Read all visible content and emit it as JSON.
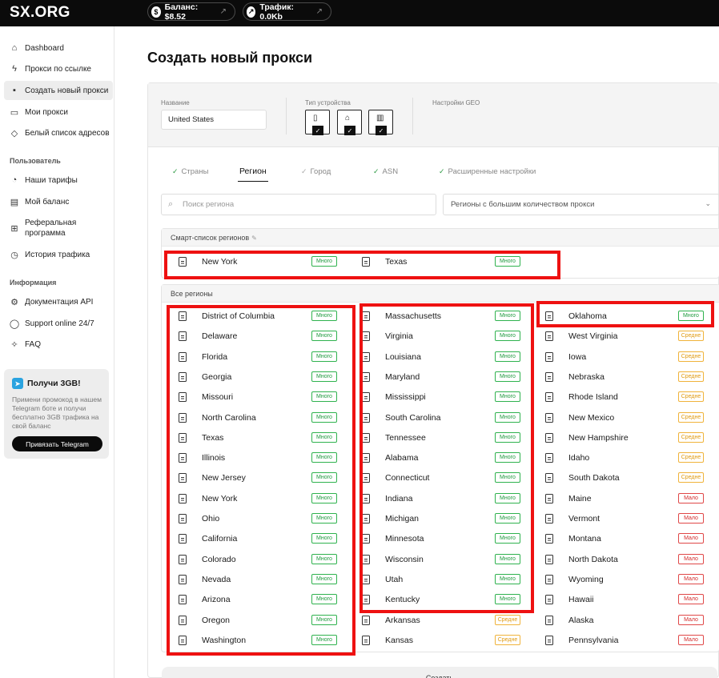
{
  "header": {
    "logo": "SX.ORG",
    "balance_label": "Баланс: $8.52",
    "traffic_label": "Трафик: 0.0Kb"
  },
  "sidebar": {
    "items": [
      {
        "label": "Dashboard",
        "icon": "home-icon"
      },
      {
        "label": "Прокси по ссылке",
        "icon": "bolt-icon"
      },
      {
        "label": "Создать новый прокси",
        "icon": "file-plus-icon",
        "active": true
      },
      {
        "label": "Мои прокси",
        "icon": "list-icon"
      },
      {
        "label": "Белый список адресов",
        "icon": "shield-icon"
      }
    ],
    "user_section": "Пользователь",
    "user_items": [
      {
        "label": "Наши тарифы",
        "icon": "tag-icon"
      },
      {
        "label": "Мой баланс",
        "icon": "wallet-icon"
      },
      {
        "label": "Реферальная программа",
        "icon": "gift-icon"
      },
      {
        "label": "История трафика",
        "icon": "clock-icon"
      }
    ],
    "info_section": "Информация",
    "info_items": [
      {
        "label": "Документация API",
        "icon": "gear-icon"
      },
      {
        "label": "Support online 24/7",
        "icon": "chat-icon"
      },
      {
        "label": "FAQ",
        "icon": "sparkle-icon"
      }
    ],
    "promo": {
      "title": "Получи 3GB!",
      "text": "Примени промокод в нашем Telegram боте и получи бесплатно 3GB трафика на свой баланс",
      "button": "Привязать Telegram"
    }
  },
  "main": {
    "title": "Создать новый прокси",
    "name_label": "Название",
    "name_value": "United States",
    "device_label": "Тип устройства",
    "geo_label": "Настройки GEO",
    "tabs": [
      {
        "label": "Страны",
        "checked": true
      },
      {
        "label": "Регион",
        "active": true
      },
      {
        "label": "Город",
        "checked": true
      },
      {
        "label": "ASN",
        "checked": true
      },
      {
        "label": "Расширенные настройки",
        "checked": true
      }
    ],
    "search_placeholder": "Поиск региона",
    "select_value": "Регионы с большим количеством прокси",
    "smart_title": "Смарт-список регионов",
    "all_title": "Все регионы",
    "bottom_button": "Создать",
    "colors": {
      "many": "#2fb24e",
      "medium": "#f0b33a",
      "few": "#e04848",
      "highlight": "#ee1111"
    }
  },
  "smart_regions": [
    {
      "name": "New York",
      "badge": "Много"
    },
    {
      "name": "Texas",
      "badge": "Много"
    }
  ],
  "regions": {
    "col1": [
      {
        "name": "District of Columbia",
        "badge": "Много",
        "level": "g"
      },
      {
        "name": "Delaware",
        "badge": "Много",
        "level": "g"
      },
      {
        "name": "Florida",
        "badge": "Много",
        "level": "g"
      },
      {
        "name": "Georgia",
        "badge": "Много",
        "level": "g"
      },
      {
        "name": "Missouri",
        "badge": "Много",
        "level": "g"
      },
      {
        "name": "North Carolina",
        "badge": "Много",
        "level": "g"
      },
      {
        "name": "Texas",
        "badge": "Много",
        "level": "g"
      },
      {
        "name": "Illinois",
        "badge": "Много",
        "level": "g"
      },
      {
        "name": "New Jersey",
        "badge": "Много",
        "level": "g"
      },
      {
        "name": "New York",
        "badge": "Много",
        "level": "g"
      },
      {
        "name": "Ohio",
        "badge": "Много",
        "level": "g"
      },
      {
        "name": "California",
        "badge": "Много",
        "level": "g"
      },
      {
        "name": "Colorado",
        "badge": "Много",
        "level": "g"
      },
      {
        "name": "Nevada",
        "badge": "Много",
        "level": "g"
      },
      {
        "name": "Arizona",
        "badge": "Много",
        "level": "g"
      },
      {
        "name": "Oregon",
        "badge": "Много",
        "level": "g"
      },
      {
        "name": "Washington",
        "badge": "Много",
        "level": "g"
      }
    ],
    "col2": [
      {
        "name": "Massachusetts",
        "badge": "Много",
        "level": "g"
      },
      {
        "name": "Virginia",
        "badge": "Много",
        "level": "g"
      },
      {
        "name": "Louisiana",
        "badge": "Много",
        "level": "g"
      },
      {
        "name": "Maryland",
        "badge": "Много",
        "level": "g"
      },
      {
        "name": "Mississippi",
        "badge": "Много",
        "level": "g"
      },
      {
        "name": "South Carolina",
        "badge": "Много",
        "level": "g"
      },
      {
        "name": "Tennessee",
        "badge": "Много",
        "level": "g"
      },
      {
        "name": "Alabama",
        "badge": "Много",
        "level": "g"
      },
      {
        "name": "Connecticut",
        "badge": "Много",
        "level": "g"
      },
      {
        "name": "Indiana",
        "badge": "Много",
        "level": "g"
      },
      {
        "name": "Michigan",
        "badge": "Много",
        "level": "g"
      },
      {
        "name": "Minnesota",
        "badge": "Много",
        "level": "g"
      },
      {
        "name": "Wisconsin",
        "badge": "Много",
        "level": "g"
      },
      {
        "name": "Utah",
        "badge": "Много",
        "level": "g"
      },
      {
        "name": "Kentucky",
        "badge": "Много",
        "level": "g"
      },
      {
        "name": "Arkansas",
        "badge": "Средне",
        "level": "y"
      },
      {
        "name": "Kansas",
        "badge": "Средне",
        "level": "y"
      }
    ],
    "col3": [
      {
        "name": "Oklahoma",
        "badge": "Много",
        "level": "g"
      },
      {
        "name": "West Virginia",
        "badge": "Средне",
        "level": "y"
      },
      {
        "name": "Iowa",
        "badge": "Средне",
        "level": "y"
      },
      {
        "name": "Nebraska",
        "badge": "Средне",
        "level": "y"
      },
      {
        "name": "Rhode Island",
        "badge": "Средне",
        "level": "y"
      },
      {
        "name": "New Mexico",
        "badge": "Средне",
        "level": "y"
      },
      {
        "name": "New Hampshire",
        "badge": "Средне",
        "level": "y"
      },
      {
        "name": "Idaho",
        "badge": "Средне",
        "level": "y"
      },
      {
        "name": "South Dakota",
        "badge": "Средне",
        "level": "y"
      },
      {
        "name": "Maine",
        "badge": "Мало",
        "level": "r"
      },
      {
        "name": "Vermont",
        "badge": "Мало",
        "level": "r"
      },
      {
        "name": "Montana",
        "badge": "Мало",
        "level": "r"
      },
      {
        "name": "North Dakota",
        "badge": "Мало",
        "level": "r"
      },
      {
        "name": "Wyoming",
        "badge": "Мало",
        "level": "r"
      },
      {
        "name": "Hawaii",
        "badge": "Мало",
        "level": "r"
      },
      {
        "name": "Alaska",
        "badge": "Мало",
        "level": "r"
      },
      {
        "name": "Pennsylvania",
        "badge": "Мало",
        "level": "r"
      }
    ]
  }
}
